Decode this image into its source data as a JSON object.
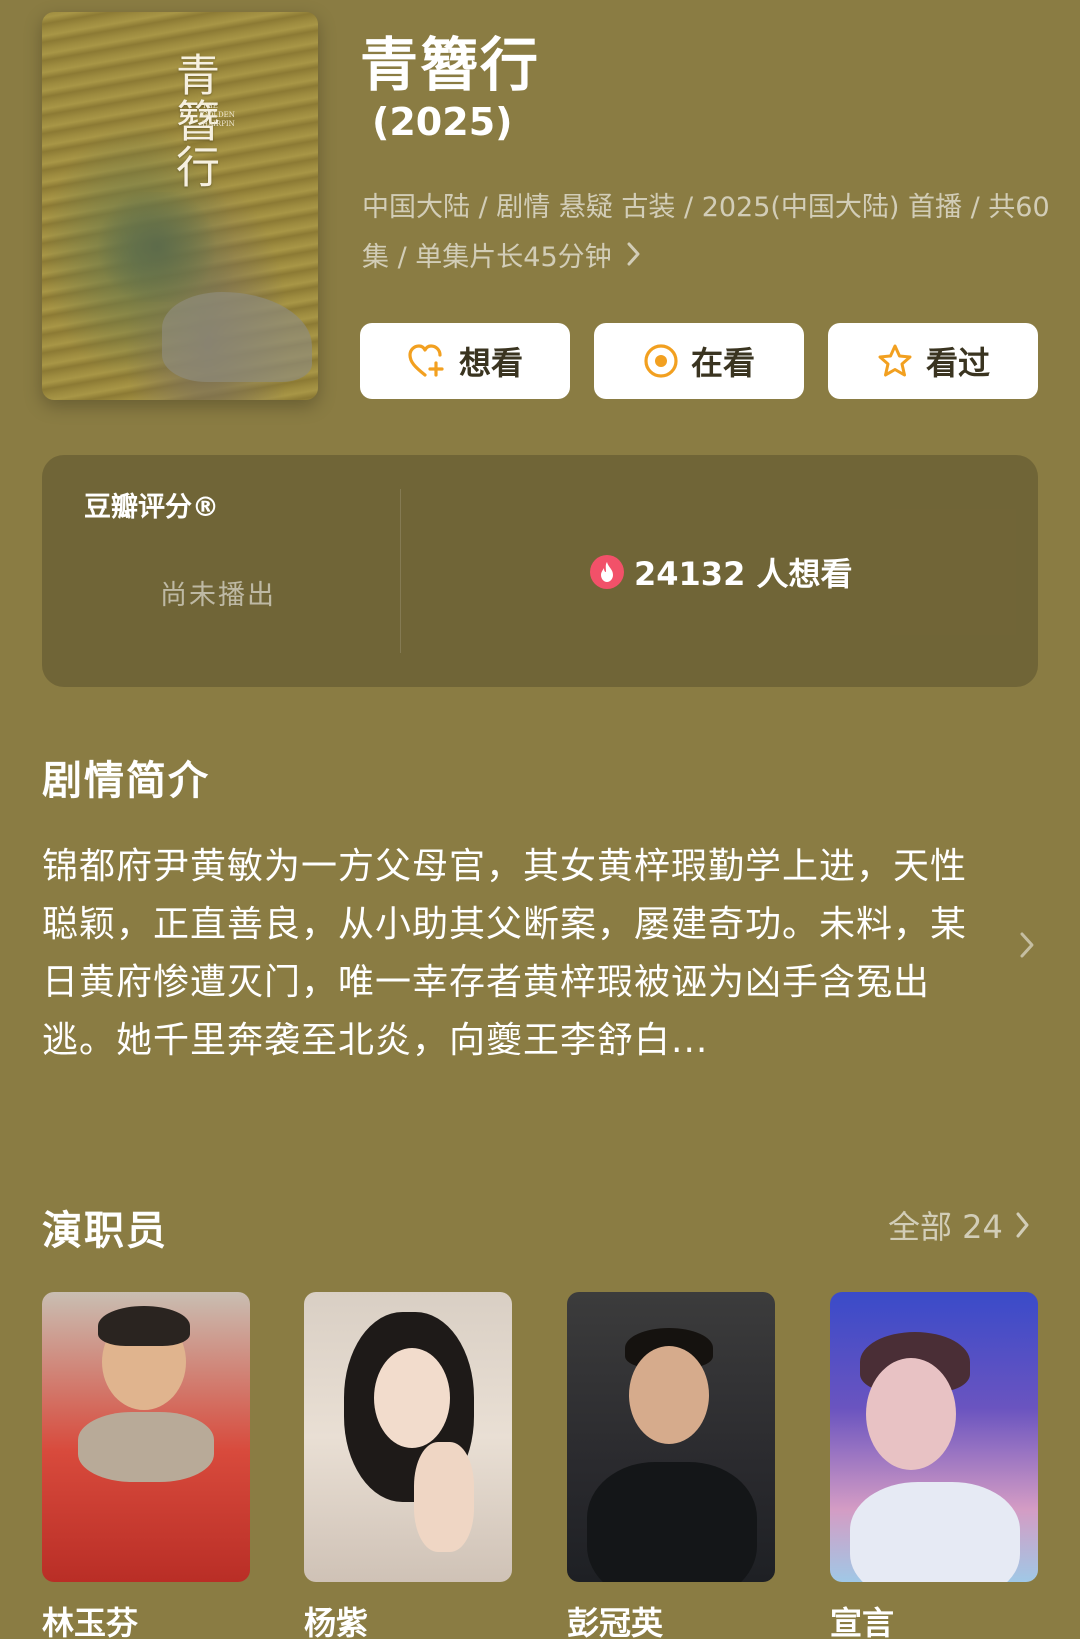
{
  "poster": {
    "title": "青簪行",
    "subtitle": "THE GOLDEN HAIRPIN"
  },
  "header": {
    "title": "青簪行",
    "year": "(2025)",
    "meta": "中国大陆 / 剧情 悬疑 古装 / 2025(中国大陆) 首播 / 共60集 / 单集片长45分钟"
  },
  "actions": {
    "want_label": "想看",
    "watching_label": "在看",
    "watched_label": "看过"
  },
  "rating": {
    "label": "豆瓣评分®",
    "status": "尚未播出",
    "want_count_text": "24132 人想看"
  },
  "synopsis": {
    "title": "剧情简介",
    "text": "锦都府尹黄敏为一方父母官，其女黄梓瑕勤学上进，天性聪颖，正直善良，从小助其父断案，屡建奇功。未料，某日黄府惨遭灭门，唯一幸存者黄梓瑕被诬为凶手含冤出逃。她千里奔袭至北炎，向夔王李舒白..."
  },
  "cast": {
    "title": "演职员",
    "all_label": "全部 24",
    "members": [
      {
        "name": "林玉芬"
      },
      {
        "name": "杨紫"
      },
      {
        "name": "彭冠英"
      },
      {
        "name": "宣言"
      }
    ]
  },
  "colors": {
    "background": "#8a7c43",
    "accent_icon": "#f2a020",
    "fire": "#f25169"
  },
  "icons": {
    "want": "heart-plus-icon",
    "watching": "target-circle-icon",
    "watched": "star-icon",
    "fire": "fire-icon",
    "chevron": "chevron-right-icon"
  }
}
